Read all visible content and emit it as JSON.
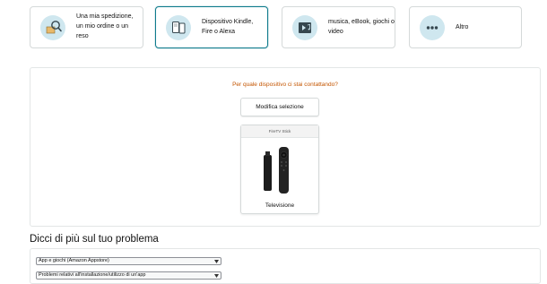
{
  "categories": [
    {
      "label": "Una mia spedizione, un mio ordine o un reso",
      "icon": "package-search-icon"
    },
    {
      "label": "Dispositivo Kindle, Fire o Alexa",
      "icon": "devices-icon",
      "selected": true
    },
    {
      "label": "musica, eBook, giochi o video",
      "icon": "media-icon"
    },
    {
      "label": "Altro",
      "icon": "more-icon"
    }
  ],
  "device_section": {
    "question": "Per quale dispositivo ci stai contattando?",
    "modify_button": "Modifica selezione",
    "device_card": {
      "header": "FireTV Stick",
      "name": "Televisione"
    }
  },
  "problem_section": {
    "title": "Dicci di più sul tuo problema",
    "select_1_value": "App e giochi (Amazon Appstore)",
    "select_2_value": "Problemi relativi all'installazione/utilizzo di un'app"
  },
  "colors": {
    "accent_teal": "#0f7b8c",
    "icon_bg": "#cfe7ef",
    "question_orange": "#c45500"
  }
}
